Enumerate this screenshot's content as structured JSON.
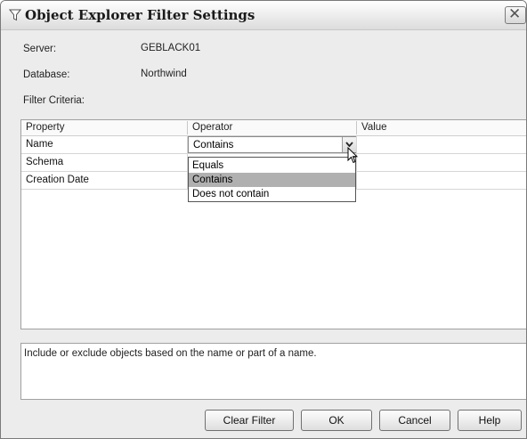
{
  "dialog": {
    "title": "Object Explorer Filter Settings",
    "title_icon": "funnel-icon",
    "close_glyph": "✕"
  },
  "info": {
    "server_label": "Server:",
    "server_value": "GEBLACK01",
    "database_label": "Database:",
    "database_value": "Northwind",
    "filter_criteria_label": "Filter Criteria:"
  },
  "grid": {
    "columns": [
      "Property",
      "Operator",
      "Value"
    ],
    "rows": [
      {
        "property": "Name",
        "operator": "Contains",
        "value": ""
      },
      {
        "property": "Schema",
        "operator": "",
        "value": ""
      },
      {
        "property": "Creation Date",
        "operator": "",
        "value": ""
      }
    ]
  },
  "operator_dropdown": {
    "options": [
      "Equals",
      "Contains",
      "Does not contain"
    ],
    "selected": "Contains"
  },
  "description": "Include or exclude objects based on the name or part of a name.",
  "buttons": {
    "clear_filter": "Clear Filter",
    "ok": "OK",
    "cancel": "Cancel",
    "help": "Help"
  },
  "colors": {
    "dialog_bg": "#ececec",
    "selected_option": "#b0b0b0"
  }
}
